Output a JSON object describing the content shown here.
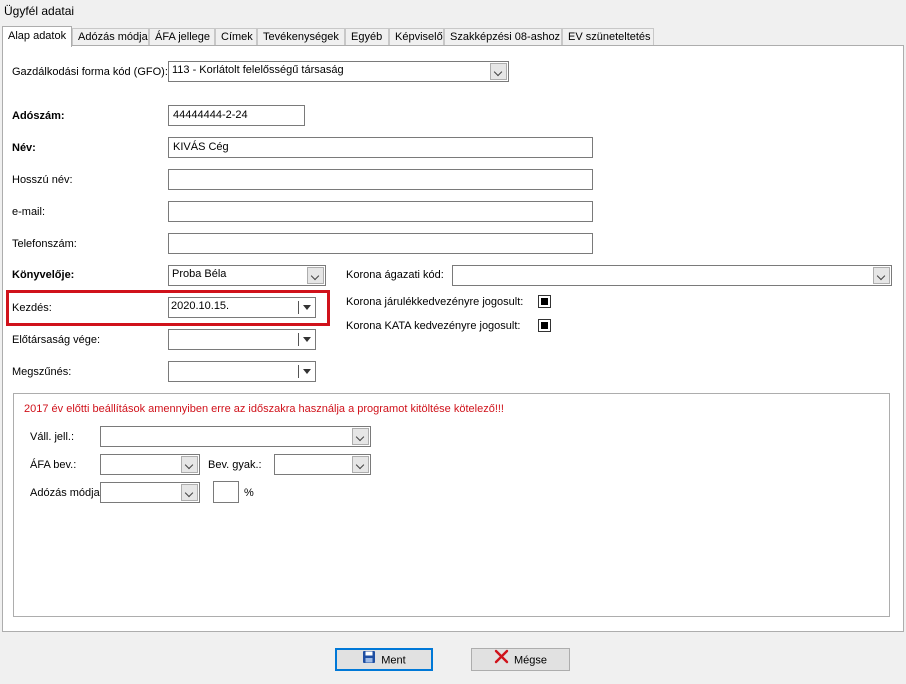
{
  "window": {
    "title": "Ügyfél adatai"
  },
  "tabs": [
    {
      "label": "Alap adatok"
    },
    {
      "label": "Adózás módja"
    },
    {
      "label": "ÁFA jellege"
    },
    {
      "label": "Címek"
    },
    {
      "label": "Tevékenységek"
    },
    {
      "label": "Egyéb"
    },
    {
      "label": "Képviselő"
    },
    {
      "label": "Szakképzési 08-ashoz"
    },
    {
      "label": "EV szüneteltetés"
    }
  ],
  "form": {
    "gfo_label": "Gazdálkodási forma kód (GFO):",
    "gfo_value": "113 - Korlátolt felelősségű társaság",
    "adoszam_label": "Adószám:",
    "adoszam_value": "44444444-2-24",
    "nev_label": "Név:",
    "nev_value": "KIVÁS Cég",
    "hosszu_nev_label": "Hosszú név:",
    "hosszu_nev_value": "",
    "email_label": "e-mail:",
    "email_value": "",
    "telefon_label": "Telefonszám:",
    "telefon_value": "",
    "konyvelo_label": "Könyvelője:",
    "konyvelo_value": "Proba Béla",
    "kezdes_label": "Kezdés:",
    "kezdes_value": "2020.10.15.",
    "elotarsasag_label": "Előtársaság vége:",
    "elotarsasag_value": "",
    "megszunes_label": "Megszűnés:",
    "megszunes_value": "",
    "korona_agazati_label": "Korona ágazati kód:",
    "korona_agazati_value": "",
    "korona_jarulek_label": "Korona járulékkedvezényre jogosult:",
    "korona_jarulek_checked": true,
    "korona_kata_label": "Korona KATA kedvezényre jogosult:",
    "korona_kata_checked": true
  },
  "legacy": {
    "warning": "2017 év előtti beállítások amennyiben erre az időszakra használja a programot kitöltése kötelező!!!",
    "vall_jell_label": "Váll. jell.:",
    "vall_jell_value": "",
    "afa_bev_label": "ÁFA bev.:",
    "afa_bev_value": "",
    "bev_gyak_label": "Bev. gyak.:",
    "bev_gyak_value": "",
    "adozas_modja_label": "Adózás módja:",
    "adozas_modja_value": "",
    "percent_value": "",
    "percent_unit": "%"
  },
  "buttons": {
    "save_label": "Ment",
    "cancel_label": "Mégse"
  },
  "colors": {
    "highlight": "#d0121b",
    "warning_text": "#d0121b",
    "save_icon": "#1f4fa3",
    "cancel_icon": "#d0121b"
  },
  "icons": {
    "save": "floppy-disk-icon",
    "cancel": "red-x-icon"
  }
}
